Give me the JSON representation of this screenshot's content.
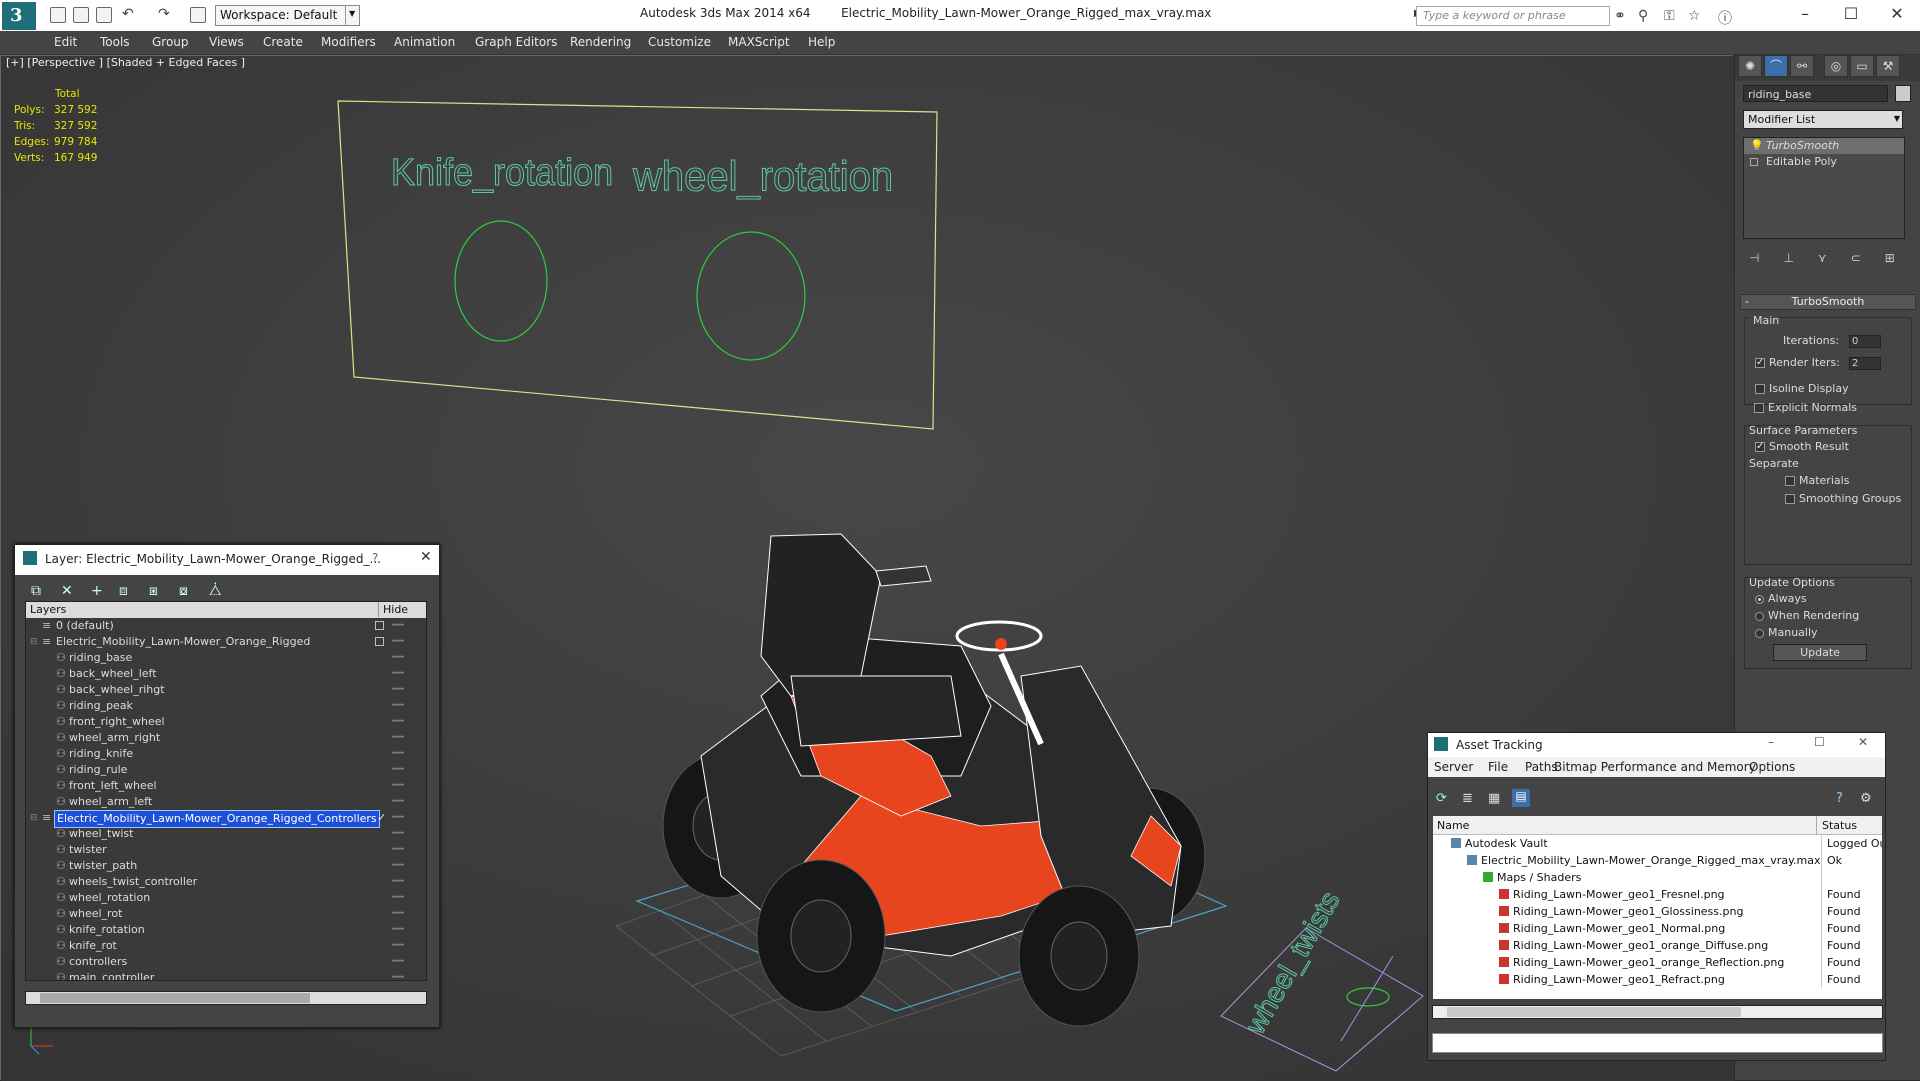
{
  "titlebar": {
    "workspace": "Workspace: Default",
    "app_title": "Autodesk 3ds Max  2014 x64",
    "file_title": "Electric_Mobility_Lawn-Mower_Orange_Rigged_max_vray.max",
    "search_placeholder": "Type a keyword or phrase"
  },
  "menu": [
    "Edit",
    "Tools",
    "Group",
    "Views",
    "Create",
    "Modifiers",
    "Animation",
    "Graph Editors",
    "Rendering",
    "Customize",
    "MAXScript",
    "Help"
  ],
  "viewport": {
    "label": "[+] [Perspective ] [Shaded + Edged Faces ]",
    "stats": {
      "header": "Total",
      "rows": [
        {
          "label": "Polys:",
          "value": "327 592"
        },
        {
          "label": "Tris:",
          "value": "327 592"
        },
        {
          "label": "Edges:",
          "value": "979 784"
        },
        {
          "label": "Verts:",
          "value": "167 949"
        }
      ]
    },
    "scene_text": {
      "knife": "Knife_rotation",
      "wheel": "wheel_rotation",
      "twists": "wheel_twists"
    },
    "colors": {
      "wire": "#ffffff",
      "orange": "#e8451e",
      "helper": "#5ec8a0",
      "circle": "#2ecc40",
      "frame": "#d8e48a",
      "grid_blue": "#4aa3c8",
      "purple": "#b08ee0"
    }
  },
  "command_panel": {
    "object_name": "riding_base",
    "modifier_list": "Modifier List",
    "stack": [
      "TurboSmooth",
      "Editable Poly"
    ],
    "rollout_title": "TurboSmooth",
    "main_label": "Main",
    "iterations_label": "Iterations:",
    "iterations_value": "0",
    "render_iters_label": "Render Iters:",
    "render_iters_value": "2",
    "isoline": "Isoline Display",
    "explicit": "Explicit Normals",
    "surface_params": "Surface Parameters",
    "smooth_result": "Smooth Result",
    "separate": "Separate",
    "materials": "Materials",
    "smoothing_groups": "Smoothing Groups",
    "update_options": "Update Options",
    "always": "Always",
    "when_rendering": "When Rendering",
    "manually": "Manually",
    "update_button": "Update"
  },
  "layer_dialog": {
    "title": "Layer: Electric_Mobility_Lawn-Mower_Orange_Rigged_...",
    "help": "?",
    "col_layers": "Layers",
    "col_hide": "Hide",
    "rows": [
      {
        "name": "0 (default)",
        "indent": 1,
        "type": "layer"
      },
      {
        "name": "Electric_Mobility_Lawn-Mower_Orange_Rigged",
        "indent": 1,
        "type": "layer"
      },
      {
        "name": "riding_base",
        "indent": 2,
        "type": "obj"
      },
      {
        "name": "back_wheel_left",
        "indent": 2,
        "type": "obj"
      },
      {
        "name": "back_wheel_rihgt",
        "indent": 2,
        "type": "obj"
      },
      {
        "name": "riding_peak",
        "indent": 2,
        "type": "obj"
      },
      {
        "name": "front_right_wheel",
        "indent": 2,
        "type": "obj"
      },
      {
        "name": "wheel_arm_right",
        "indent": 2,
        "type": "obj"
      },
      {
        "name": "riding_knife",
        "indent": 2,
        "type": "obj"
      },
      {
        "name": "riding_rule",
        "indent": 2,
        "type": "obj"
      },
      {
        "name": "front_left_wheel",
        "indent": 2,
        "type": "obj"
      },
      {
        "name": "wheel_arm_left",
        "indent": 2,
        "type": "obj"
      },
      {
        "name": "Electric_Mobility_Lawn-Mower_Orange_Rigged_Controllers",
        "indent": 1,
        "type": "layer"
      },
      {
        "name": "wheel_twist",
        "indent": 2,
        "type": "obj"
      },
      {
        "name": "twister",
        "indent": 2,
        "type": "obj"
      },
      {
        "name": "twister_path",
        "indent": 2,
        "type": "obj"
      },
      {
        "name": "wheels_twist_controller",
        "indent": 2,
        "type": "obj"
      },
      {
        "name": "wheel_rotation",
        "indent": 2,
        "type": "obj"
      },
      {
        "name": "wheel_rot",
        "indent": 2,
        "type": "obj"
      },
      {
        "name": "knife_rotation",
        "indent": 2,
        "type": "obj"
      },
      {
        "name": "knife_rot",
        "indent": 2,
        "type": "obj"
      },
      {
        "name": "controllers",
        "indent": 2,
        "type": "obj"
      },
      {
        "name": "main_controller",
        "indent": 2,
        "type": "obj"
      }
    ]
  },
  "asset_dialog": {
    "title": "Asset Tracking",
    "menu": [
      "Server",
      "File",
      "Paths",
      "Bitmap Performance and Memory",
      "Options"
    ],
    "col_name": "Name",
    "col_status": "Status",
    "rows": [
      {
        "name": "Autodesk Vault",
        "status": "Logged Ou",
        "indent": 1
      },
      {
        "name": "Electric_Mobility_Lawn-Mower_Orange_Rigged_max_vray.max",
        "status": "Ok",
        "indent": 2
      },
      {
        "name": "Maps / Shaders",
        "status": "",
        "indent": 3
      },
      {
        "name": "Riding_Lawn-Mower_geo1_Fresnel.png",
        "status": "Found",
        "indent": 4
      },
      {
        "name": "Riding_Lawn-Mower_geo1_Glossiness.png",
        "status": "Found",
        "indent": 4
      },
      {
        "name": "Riding_Lawn-Mower_geo1_Normal.png",
        "status": "Found",
        "indent": 4
      },
      {
        "name": "Riding_Lawn-Mower_geo1_orange_Diffuse.png",
        "status": "Found",
        "indent": 4
      },
      {
        "name": "Riding_Lawn-Mower_geo1_orange_Reflection.png",
        "status": "Found",
        "indent": 4
      },
      {
        "name": "Riding_Lawn-Mower_geo1_Refract.png",
        "status": "Found",
        "indent": 4
      }
    ]
  }
}
